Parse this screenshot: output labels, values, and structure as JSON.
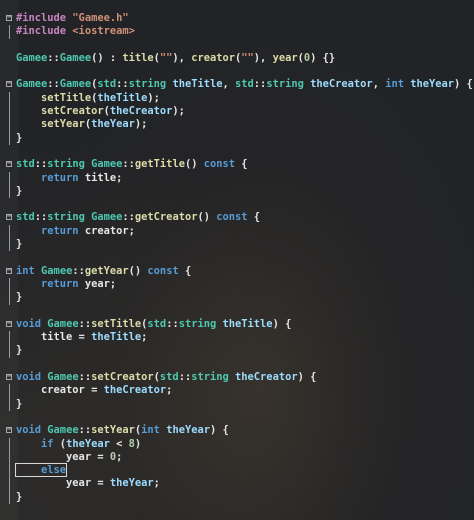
{
  "code": {
    "lines": [
      "#include \"Gamee.h\"",
      "#include <iostream>",
      "",
      "Gamee::Gamee() : title(\"\"), creator(\"\"), year(0) {}",
      "",
      "Gamee::Gamee(std::string theTitle, std::string theCreator, int theYear) {",
      "    setTitle(theTitle);",
      "    setCreator(theCreator);",
      "    setYear(theYear);",
      "}",
      "",
      "std::string Gamee::getTitle() const {",
      "    return title;",
      "}",
      "",
      "std::string Gamee::getCreator() const {",
      "    return creator;",
      "}",
      "",
      "int Gamee::getYear() const {",
      "    return year;",
      "}",
      "",
      "void Gamee::setTitle(std::string theTitle) {",
      "    title = theTitle;",
      "}",
      "",
      "void Gamee::setCreator(std::string theCreator) {",
      "    creator = theCreator;",
      "}",
      "",
      "void Gamee::setYear(int theYear) {",
      "    if (theYear < 8)",
      "        year = 0;",
      "    else",
      "        year = theYear;",
      "}"
    ],
    "folded_markers": "collapse",
    "colors": {
      "background": "#222326",
      "keyword": "#569cd6",
      "type": "#4ec9b0",
      "function": "#dcdcaa",
      "string": "#ce9178",
      "number": "#b5cea8"
    }
  }
}
